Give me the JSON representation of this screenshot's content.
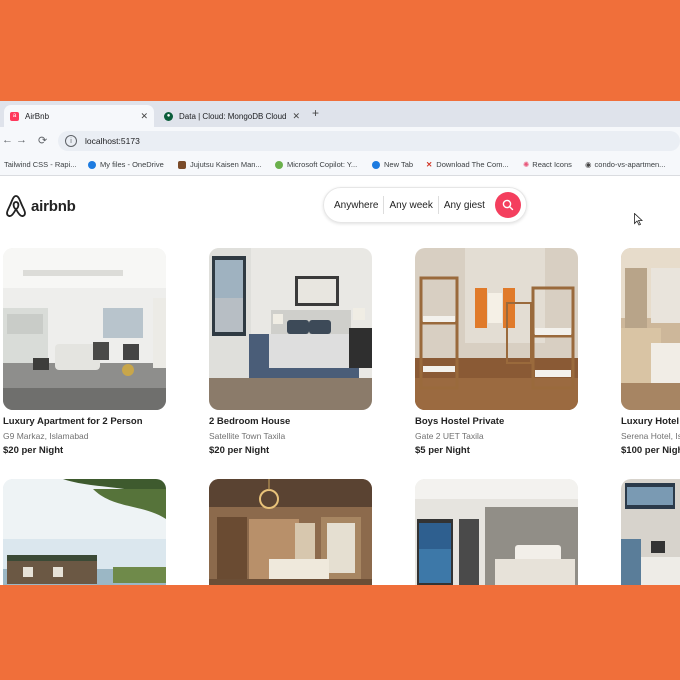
{
  "browser": {
    "tabs": [
      {
        "title": "AirBnb",
        "active": true
      },
      {
        "title": "Data | Cloud: MongoDB Cloud",
        "active": false
      }
    ],
    "url": "localhost:5173",
    "bookmarks": [
      "Tailwind CSS - Rapi...",
      "My files - OneDrive",
      "Jujutsu Kaisen Man...",
      "Microsoft Copilot: Y...",
      "New Tab",
      "Download The Com...",
      "React Icons",
      "condo-vs-apartmen..."
    ]
  },
  "header": {
    "logo_text": "airbnb",
    "search": {
      "anywhere": "Anywhere",
      "week": "Any week",
      "guests": "Any giest"
    }
  },
  "colors": {
    "accent": "#f43f5e",
    "frame": "#f06f3a"
  },
  "listings": [
    {
      "name": "Luxury Apartment for 2 Person",
      "location": "G9 Markaz, Islamabad",
      "price": "$20 per Night"
    },
    {
      "name": "2 Bedroom House",
      "location": "Satellite Town Taxila",
      "price": "$20 per Night"
    },
    {
      "name": "Boys Hostel Private",
      "location": "Gate 2 UET Taxila",
      "price": "$5 per Night"
    },
    {
      "name": "Luxury Hotel",
      "location": "Serena Hotel, Is",
      "price": "$100 per Nigh"
    },
    {
      "name": "",
      "location": "",
      "price": ""
    },
    {
      "name": "",
      "location": "",
      "price": ""
    },
    {
      "name": "",
      "location": "",
      "price": ""
    },
    {
      "name": "",
      "location": "",
      "price": ""
    }
  ]
}
